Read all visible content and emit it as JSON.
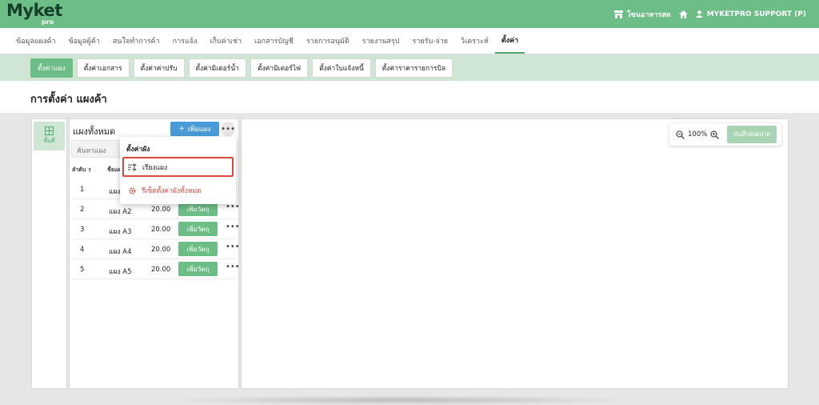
{
  "topbar": {
    "logo_main": "Myket",
    "logo_sub": "pro",
    "market_name": "โซนอาหารสด",
    "user_name": "MYKETPRO SUPPORT (P)"
  },
  "nav": {
    "items": [
      {
        "label": "ข้อมูลแผงค้า"
      },
      {
        "label": "ข้อมูลผู้ค้า"
      },
      {
        "label": "สนใจทำการค้า"
      },
      {
        "label": "การแจ้ง"
      },
      {
        "label": "เก็บค่าเช่า"
      },
      {
        "label": "เอกสารบัญชี"
      },
      {
        "label": "รายการอนุมัติ"
      },
      {
        "label": "รายงานสรุป"
      },
      {
        "label": "รายรับ-จ่าย"
      },
      {
        "label": "วิเคราะห์"
      },
      {
        "label": "ตั้งค่า"
      }
    ],
    "active_index": 10
  },
  "subnav": {
    "items": [
      {
        "label": "ตั้งค่าแผง"
      },
      {
        "label": "ตั้งค่าเอกสาร"
      },
      {
        "label": "ตั้งค่าค่าปรับ"
      },
      {
        "label": "ตั้งค่ามิเตอร์น้ำ"
      },
      {
        "label": "ตั้งค่ามิเตอร์ไฟ"
      },
      {
        "label": "ตั้งค่าใบแจ้งหนี้"
      },
      {
        "label": "ตั้งค่าราคารายการบิล"
      }
    ],
    "active_index": 0
  },
  "page": {
    "title": "การตั้งค่า แผงค้า"
  },
  "rail": {
    "area_label": "พื้นที่"
  },
  "panel": {
    "title": "แผงทั้งหมด",
    "add_label": "เพิ่มแผง",
    "search_placeholder": "ค้นหาแผง",
    "col_order": "ลำดับ",
    "col_name": "ชื่อแผ",
    "rows": [
      {
        "num": "1",
        "name": "แผง",
        "price": "",
        "action": ""
      },
      {
        "num": "2",
        "name": "แผง A2",
        "price": "20.00",
        "action": "เพิ่มวัตถุ"
      },
      {
        "num": "3",
        "name": "แผง A3",
        "price": "20.00",
        "action": "เพิ่มวัตถุ"
      },
      {
        "num": "4",
        "name": "แผง A4",
        "price": "20.00",
        "action": "เพิ่มวัตถุ"
      },
      {
        "num": "5",
        "name": "แผง A5",
        "price": "20.00",
        "action": "เพิ่มวัตถุ"
      }
    ]
  },
  "dropdown": {
    "title": "ตั้งค่าผัง",
    "sort_label": "เรียงแผง",
    "reset_label": "รีเซ็ตตั้งค่าผังทั้งหมด"
  },
  "canvas": {
    "zoom_level": "100%",
    "save_label": "บันทึกผังตลาด"
  },
  "colors": {
    "brand_green": "#6cbd86",
    "primary_blue": "#4a9bd9",
    "danger_red": "#d9483b"
  }
}
